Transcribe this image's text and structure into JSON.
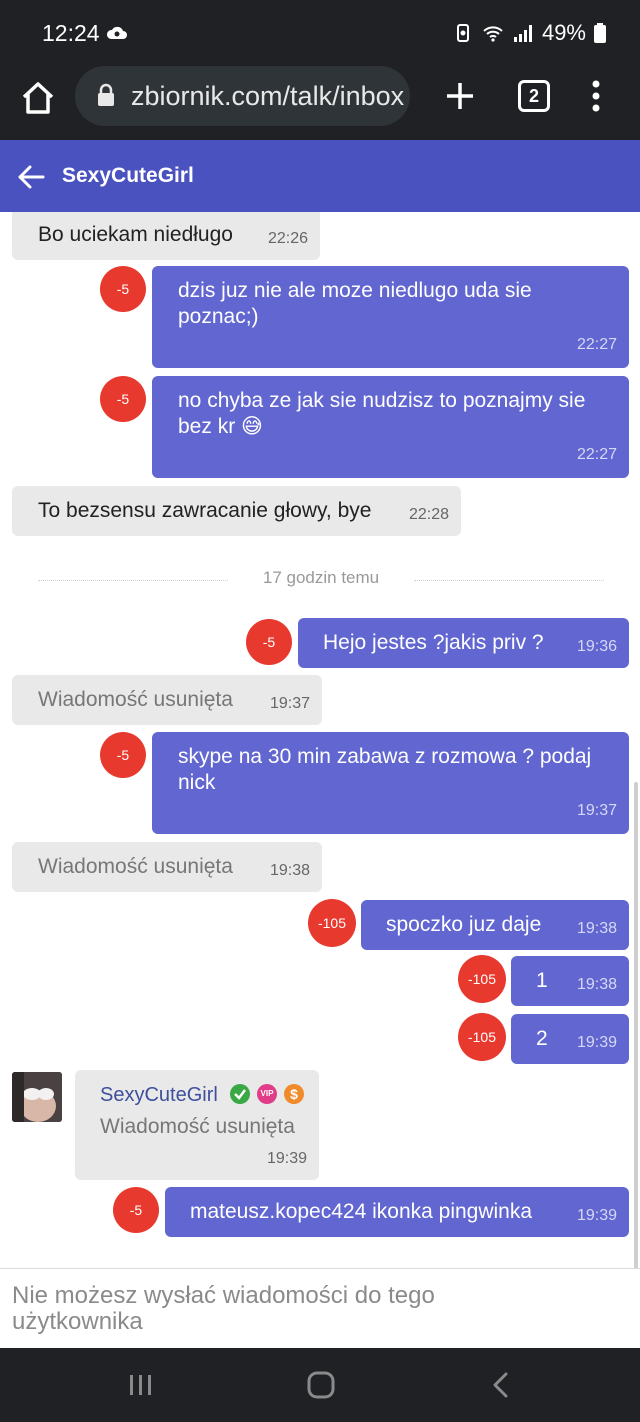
{
  "status_bar": {
    "time": "12:24",
    "battery": "49%"
  },
  "browser": {
    "url": "zbiornik.com/talk/inbox",
    "tab_count": "2"
  },
  "header": {
    "title": "SexyCuteGirl"
  },
  "messages": [
    {
      "dir": "in",
      "text": "Bo uciekam niedługo",
      "time": "22:26"
    },
    {
      "dir": "out",
      "badge": "-5",
      "text": "dzis juz nie ale moze niedlugo uda sie poznac;)",
      "time": "22:27"
    },
    {
      "dir": "out",
      "badge": "-5",
      "text": "no chyba ze jak sie nudzisz to poznajmy sie bez kr 😅",
      "time": "22:27"
    },
    {
      "dir": "in",
      "text": "To bezsensu zawracanie głowy, bye",
      "time": "22:28"
    },
    {
      "dir": "out",
      "badge": "-5",
      "text": "Hejo jestes ?jakis priv ?",
      "time": "19:36"
    },
    {
      "dir": "in",
      "deleted": true,
      "text": "Wiadomość usunięta",
      "time": "19:37"
    },
    {
      "dir": "out",
      "badge": "-5",
      "text": "skype na 30 min zabawa z rozmowa ? podaj nick",
      "time": "19:37"
    },
    {
      "dir": "in",
      "deleted": true,
      "text": "Wiadomość usunięta",
      "time": "19:38"
    },
    {
      "dir": "out",
      "badge": "-105",
      "text": "spoczko juz daje",
      "time": "19:38"
    },
    {
      "dir": "out",
      "badge": "-105",
      "text": "1",
      "time": "19:38"
    },
    {
      "dir": "out",
      "badge": "-105",
      "text": "2",
      "time": "19:39"
    },
    {
      "dir": "in",
      "deleted": true,
      "sender": "SexyCuteGirl",
      "sender_badges": [
        "verified-icon",
        "vip-icon",
        "dollar-icon"
      ],
      "vip_label": "VIP",
      "dollar_label": "$",
      "text": "Wiadomość usunięta",
      "time": "19:39"
    },
    {
      "dir": "out",
      "badge": "-5",
      "text": "mateusz.kopec424 ikonka pingwinka",
      "time": "19:39"
    }
  ],
  "separator": {
    "label": "17 godzin temu"
  },
  "footer": {
    "notice": "Nie możesz wysłać wiadomości do tego użytkownika"
  },
  "colors": {
    "header": "#4a52bf",
    "outgoing": "#6166d0",
    "incoming": "#e9e9e9",
    "badge": "#e8392f"
  }
}
